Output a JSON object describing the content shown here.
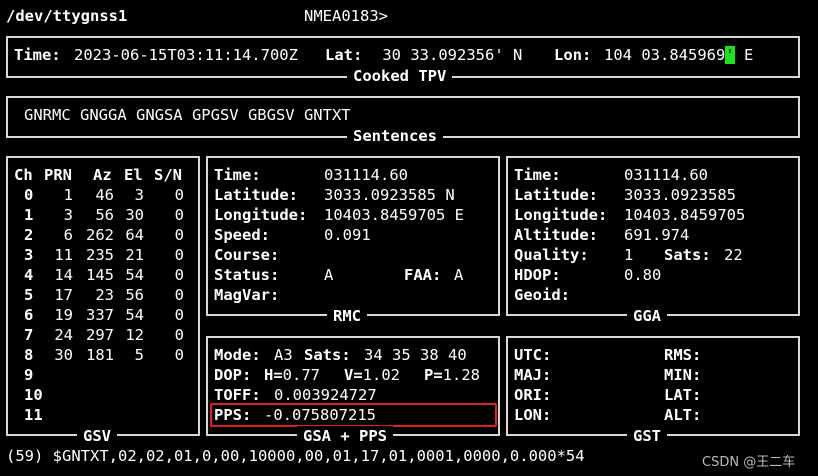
{
  "header": {
    "device": "/dev/ttygnss1",
    "mode": "NMEA0183>"
  },
  "tpv": {
    "title": "Cooked TPV",
    "time_label": "Time:",
    "time": "2023-06-15T03:11:14.700Z",
    "lat_label": "Lat:",
    "lat": " 30 33.092356' N",
    "lon_label": "Lon:",
    "lon_deg": "104 03.845969",
    "lon_cursor": "'",
    "lon_dir": " E"
  },
  "sentences": {
    "title": "Sentences",
    "list": "GNRMC GNGGA GNGSA GPGSV GBGSV GNTXT"
  },
  "gsv": {
    "title": "GSV",
    "headers": [
      "Ch",
      "PRN",
      "Az",
      "El",
      "S/N"
    ],
    "rows": [
      {
        "ch": "0",
        "prn": "1",
        "az": "46",
        "el": "3",
        "sn": "0"
      },
      {
        "ch": "1",
        "prn": "3",
        "az": "56",
        "el": "30",
        "sn": "0"
      },
      {
        "ch": "2",
        "prn": "6",
        "az": "262",
        "el": "64",
        "sn": "0"
      },
      {
        "ch": "3",
        "prn": "11",
        "az": "235",
        "el": "21",
        "sn": "0"
      },
      {
        "ch": "4",
        "prn": "14",
        "az": "145",
        "el": "54",
        "sn": "0"
      },
      {
        "ch": "5",
        "prn": "17",
        "az": "23",
        "el": "56",
        "sn": "0"
      },
      {
        "ch": "6",
        "prn": "19",
        "az": "337",
        "el": "54",
        "sn": "0"
      },
      {
        "ch": "7",
        "prn": "24",
        "az": "297",
        "el": "12",
        "sn": "0"
      },
      {
        "ch": "8",
        "prn": "30",
        "az": "181",
        "el": "5",
        "sn": "0"
      },
      {
        "ch": "9",
        "prn": "",
        "az": "",
        "el": "",
        "sn": ""
      },
      {
        "ch": "10",
        "prn": "",
        "az": "",
        "el": "",
        "sn": ""
      },
      {
        "ch": "11",
        "prn": "",
        "az": "",
        "el": "",
        "sn": ""
      }
    ]
  },
  "rmc": {
    "title": "RMC",
    "time_label": "Time:",
    "time": "031114.60",
    "lat_label": "Latitude:",
    "lat": "3033.0923585 N",
    "lon_label": "Longitude:",
    "lon": "10403.8459705 E",
    "speed_label": "Speed:",
    "speed": "0.091",
    "course_label": "Course:",
    "course": "",
    "status_label": "Status:",
    "status": "A",
    "faa_label": "FAA:",
    "faa": "A",
    "magvar_label": "MagVar:",
    "magvar": ""
  },
  "gga": {
    "title": "GGA",
    "time_label": "Time:",
    "time": "031114.60",
    "lat_label": "Latitude:",
    "lat": "3033.0923585",
    "lon_label": "Longitude:",
    "lon": "10403.8459705",
    "alt_label": "Altitude:",
    "alt": "691.974",
    "quality_label": "Quality:",
    "quality": "1",
    "sats_label": "Sats:",
    "sats": "22",
    "hdop_label": "HDOP:",
    "hdop": "0.80",
    "geoid_label": "Geoid:",
    "geoid": ""
  },
  "gsa": {
    "title": "GSA + PPS",
    "mode_label": "Mode:",
    "mode": "A3",
    "sats_label": "Sats:",
    "sats": "34 35 38 40",
    "dop_label": "DOP:",
    "h_label": "H=",
    "h": "0.77",
    "v_label": "V=",
    "v": "1.02",
    "p_label": "P=",
    "p": "1.28",
    "toff_label": "TOFF:",
    "toff": "0.003924727",
    "pps_label": "PPS:",
    "pps": "-0.075807215"
  },
  "gst": {
    "title": "GST",
    "utc_label": "UTC:",
    "rms_label": "RMS:",
    "maj_label": "MAJ:",
    "min_label": "MIN:",
    "ori_label": "ORI:",
    "lat_label": "LAT:",
    "lon_label": "LON:",
    "alt_label": "ALT:"
  },
  "footer": {
    "raw_line": "(59) $GNTXT,02,02,01,0,00,10000,00,01,17,01,0001,0000,0.000*54"
  },
  "watermark": "CSDN @王二车",
  "colors": {
    "cursor": "#19e619",
    "highlight": "#e02020"
  }
}
